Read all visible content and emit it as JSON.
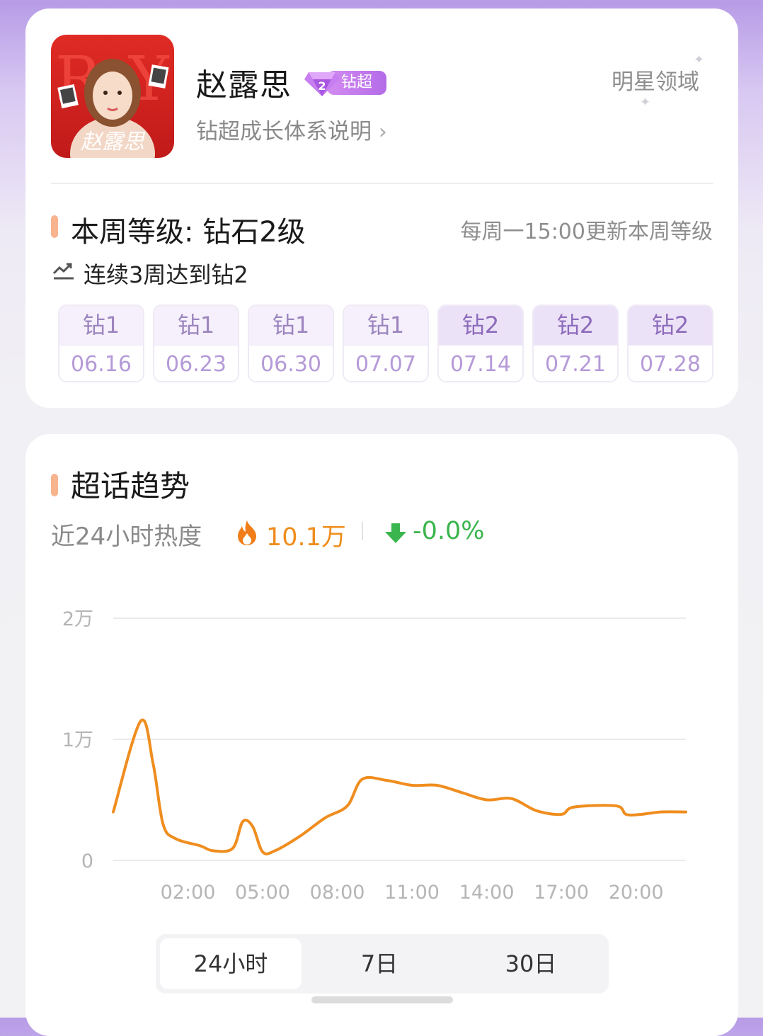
{
  "profile": {
    "name": "赵露思",
    "avatar_caption": "赵露思",
    "badge_label": "钻超",
    "badge_level": "2",
    "growth_link": "钻超成长体系说明",
    "chevron": "›",
    "star_domain": "明星领域"
  },
  "level": {
    "title": "本周等级: 钻石2级",
    "update_note": "每周一15:00更新本周等级",
    "streak": "连续3周达到钻2",
    "weeks": [
      {
        "level": "钻1",
        "date": "06.16"
      },
      {
        "level": "钻1",
        "date": "06.23"
      },
      {
        "level": "钻1",
        "date": "06.30"
      },
      {
        "level": "钻1",
        "date": "07.07"
      },
      {
        "level": "钻2",
        "date": "07.14"
      },
      {
        "level": "钻2",
        "date": "07.21"
      },
      {
        "level": "钻2",
        "date": "07.28"
      }
    ]
  },
  "trend": {
    "title": "超话趋势",
    "heat_label": "近24小时热度",
    "heat_value": "10.1万",
    "change": "-0.0%",
    "tabs": [
      "24小时",
      "7日",
      "30日"
    ],
    "active_tab": 0
  },
  "colors": {
    "accent_orange": "#ef8d1e",
    "down_green": "#3bb54d",
    "diamond_purple": "#b46be8",
    "accent_bar": "#f7b48f"
  },
  "chart_data": {
    "type": "line",
    "title": "",
    "xlabel": "",
    "ylabel": "",
    "ylim": [
      0,
      20000
    ],
    "ytick_labels": [
      "0",
      "1万",
      "2万"
    ],
    "yticks": [
      0,
      10000,
      20000
    ],
    "xtick_labels": [
      "02:00",
      "05:00",
      "08:00",
      "11:00",
      "14:00",
      "17:00",
      "20:00"
    ],
    "xticks": [
      2,
      5,
      8,
      11,
      14,
      17,
      20
    ],
    "xlim": [
      -1,
      22
    ],
    "grid": true,
    "series": [
      {
        "color": "#ef8d1e",
        "points": [
          [
            -1,
            4000
          ],
          [
            0.1,
            11500
          ],
          [
            0.6,
            8000
          ],
          [
            1,
            3000
          ],
          [
            1.5,
            1800
          ],
          [
            2.5,
            1200
          ],
          [
            3,
            800
          ],
          [
            3.8,
            1000
          ],
          [
            4.2,
            3200
          ],
          [
            4.6,
            2800
          ],
          [
            5,
            700
          ],
          [
            5.5,
            800
          ],
          [
            6.5,
            2000
          ],
          [
            7.5,
            3500
          ],
          [
            8.4,
            4500
          ],
          [
            9,
            6700
          ],
          [
            10,
            6600
          ],
          [
            11,
            6200
          ],
          [
            12,
            6200
          ],
          [
            13,
            5600
          ],
          [
            14,
            5000
          ],
          [
            15,
            5100
          ],
          [
            16,
            4100
          ],
          [
            17,
            3800
          ],
          [
            17.5,
            4400
          ],
          [
            19.2,
            4500
          ],
          [
            19.6,
            3800
          ],
          [
            20.2,
            3800
          ],
          [
            21,
            4000
          ],
          [
            22,
            4000
          ]
        ]
      }
    ]
  }
}
